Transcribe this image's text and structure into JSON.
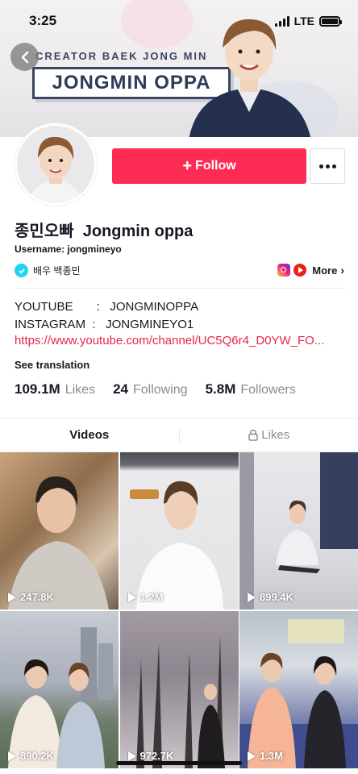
{
  "status_bar": {
    "time": "3:25",
    "network": "LTE"
  },
  "banner": {
    "subtitle": "CREATOR BAEK JONG MIN",
    "title": "JONGMIN OPPA"
  },
  "profile": {
    "display_name": "종민오빠  Jongmin oppa",
    "username": "Username: jongmineyo",
    "verified_label": "배우 백종민",
    "follow_label": "Follow",
    "more_label": "More"
  },
  "bio": {
    "line1": "YOUTUBE       :   JONGMINOPPA",
    "line2": "INSTAGRAM  :   JONGMINEYO1",
    "link": "https://www.youtube.com/channel/UC5Q6r4_D0YW_FO...",
    "see_translation": "See translation"
  },
  "stats": [
    {
      "value": "109.1M",
      "label": "Likes"
    },
    {
      "value": "24",
      "label": "Following"
    },
    {
      "value": "5.8M",
      "label": "Followers"
    }
  ],
  "tabs": {
    "videos": "Videos",
    "likes": "Likes"
  },
  "videos": [
    {
      "views": "247.8K"
    },
    {
      "views": "1.2M"
    },
    {
      "views": "899.4K"
    },
    {
      "views": "890.2K"
    },
    {
      "views": "972.7K"
    },
    {
      "views": "1.3M"
    }
  ],
  "colors": {
    "accent": "#fe2c55",
    "link": "#e8254f",
    "verified": "#20d5ec",
    "muted": "#8a8b91"
  }
}
